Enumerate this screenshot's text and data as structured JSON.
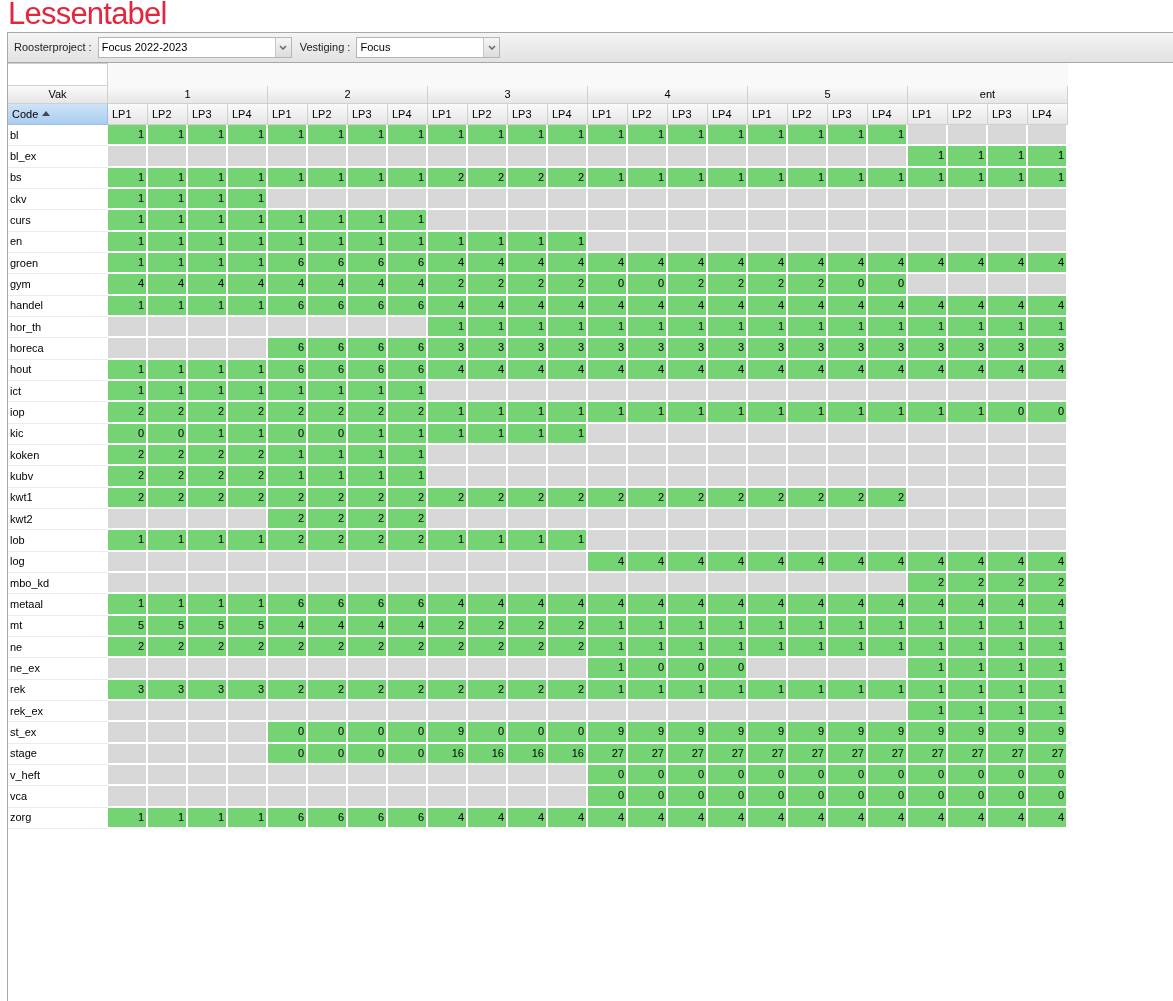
{
  "page_title": "Lessentabel",
  "toolbar": {
    "fields": [
      {
        "label": "Roosterproject :",
        "value": "Focus 2022-2023"
      },
      {
        "label": "Vestiging :",
        "value": "Focus"
      }
    ]
  },
  "table": {
    "corner_header": "Vak",
    "code_header": "Code",
    "sort_ascending": true,
    "groups": [
      {
        "label": "1",
        "periods": [
          "LP1",
          "LP2",
          "LP3",
          "LP4"
        ]
      },
      {
        "label": "2",
        "periods": [
          "LP1",
          "LP2",
          "LP3",
          "LP4"
        ]
      },
      {
        "label": "3",
        "periods": [
          "LP1",
          "LP2",
          "LP3",
          "LP4"
        ]
      },
      {
        "label": "4",
        "periods": [
          "LP1",
          "LP2",
          "LP3",
          "LP4"
        ]
      },
      {
        "label": "5",
        "periods": [
          "LP1",
          "LP2",
          "LP3",
          "LP4"
        ]
      },
      {
        "label": "ent",
        "periods": [
          "LP1",
          "LP2",
          "LP3",
          "LP4"
        ]
      }
    ],
    "rows": [
      {
        "code": "bl",
        "cells": [
          "1",
          "1",
          "1",
          "1",
          "1",
          "1",
          "1",
          "1",
          "1",
          "1",
          "1",
          "1",
          "1",
          "1",
          "1",
          "1",
          "1",
          "1",
          "1",
          "1",
          null,
          null,
          null,
          null
        ]
      },
      {
        "code": "bl_ex",
        "cells": [
          null,
          null,
          null,
          null,
          null,
          null,
          null,
          null,
          null,
          null,
          null,
          null,
          null,
          null,
          null,
          null,
          null,
          null,
          null,
          null,
          "1",
          "1",
          "1",
          "1"
        ]
      },
      {
        "code": "bs",
        "cells": [
          "1",
          "1",
          "1",
          "1",
          "1",
          "1",
          "1",
          "1",
          "2",
          "2",
          "2",
          "2",
          "1",
          "1",
          "1",
          "1",
          "1",
          "1",
          "1",
          "1",
          "1",
          "1",
          "1",
          "1"
        ]
      },
      {
        "code": "ckv",
        "cells": [
          "1",
          "1",
          "1",
          "1",
          null,
          null,
          null,
          null,
          null,
          null,
          null,
          null,
          null,
          null,
          null,
          null,
          null,
          null,
          null,
          null,
          null,
          null,
          null,
          null
        ]
      },
      {
        "code": "curs",
        "cells": [
          "1",
          "1",
          "1",
          "1",
          "1",
          "1",
          "1",
          "1",
          null,
          null,
          null,
          null,
          null,
          null,
          null,
          null,
          null,
          null,
          null,
          null,
          null,
          null,
          null,
          null
        ]
      },
      {
        "code": "en",
        "cells": [
          "1",
          "1",
          "1",
          "1",
          "1",
          "1",
          "1",
          "1",
          "1",
          "1",
          "1",
          "1",
          null,
          null,
          null,
          null,
          null,
          null,
          null,
          null,
          null,
          null,
          null,
          null
        ]
      },
      {
        "code": "groen",
        "cells": [
          "1",
          "1",
          "1",
          "1",
          "6",
          "6",
          "6",
          "6",
          "4",
          "4",
          "4",
          "4",
          "4",
          "4",
          "4",
          "4",
          "4",
          "4",
          "4",
          "4",
          "4",
          "4",
          "4",
          "4"
        ]
      },
      {
        "code": "gym",
        "cells": [
          "4",
          "4",
          "4",
          "4",
          "4",
          "4",
          "4",
          "4",
          "2",
          "2",
          "2",
          "2",
          "0",
          "0",
          "2",
          "2",
          "2",
          "2",
          "0",
          "0",
          null,
          null,
          null,
          null
        ]
      },
      {
        "code": "handel",
        "cells": [
          "1",
          "1",
          "1",
          "1",
          "6",
          "6",
          "6",
          "6",
          "4",
          "4",
          "4",
          "4",
          "4",
          "4",
          "4",
          "4",
          "4",
          "4",
          "4",
          "4",
          "4",
          "4",
          "4",
          "4"
        ]
      },
      {
        "code": "hor_th",
        "cells": [
          null,
          null,
          null,
          null,
          null,
          null,
          null,
          null,
          "1",
          "1",
          "1",
          "1",
          "1",
          "1",
          "1",
          "1",
          "1",
          "1",
          "1",
          "1",
          "1",
          "1",
          "1",
          "1"
        ]
      },
      {
        "code": "horeca",
        "cells": [
          null,
          null,
          null,
          null,
          "6",
          "6",
          "6",
          "6",
          "3",
          "3",
          "3",
          "3",
          "3",
          "3",
          "3",
          "3",
          "3",
          "3",
          "3",
          "3",
          "3",
          "3",
          "3",
          "3"
        ]
      },
      {
        "code": "hout",
        "cells": [
          "1",
          "1",
          "1",
          "1",
          "6",
          "6",
          "6",
          "6",
          "4",
          "4",
          "4",
          "4",
          "4",
          "4",
          "4",
          "4",
          "4",
          "4",
          "4",
          "4",
          "4",
          "4",
          "4",
          "4"
        ]
      },
      {
        "code": "ict",
        "cells": [
          "1",
          "1",
          "1",
          "1",
          "1",
          "1",
          "1",
          "1",
          null,
          null,
          null,
          null,
          null,
          null,
          null,
          null,
          null,
          null,
          null,
          null,
          null,
          null,
          null,
          null
        ]
      },
      {
        "code": "iop",
        "cells": [
          "2",
          "2",
          "2",
          "2",
          "2",
          "2",
          "2",
          "2",
          "1",
          "1",
          "1",
          "1",
          "1",
          "1",
          "1",
          "1",
          "1",
          "1",
          "1",
          "1",
          "1",
          "1",
          "0",
          "0"
        ]
      },
      {
        "code": "kic",
        "cells": [
          "0",
          "0",
          "1",
          "1",
          "0",
          "0",
          "1",
          "1",
          "1",
          "1",
          "1",
          "1",
          null,
          null,
          null,
          null,
          null,
          null,
          null,
          null,
          null,
          null,
          null,
          null
        ]
      },
      {
        "code": "koken",
        "cells": [
          "2",
          "2",
          "2",
          "2",
          "1",
          "1",
          "1",
          "1",
          null,
          null,
          null,
          null,
          null,
          null,
          null,
          null,
          null,
          null,
          null,
          null,
          null,
          null,
          null,
          null
        ]
      },
      {
        "code": "kubv",
        "cells": [
          "2",
          "2",
          "2",
          "2",
          "1",
          "1",
          "1",
          "1",
          null,
          null,
          null,
          null,
          null,
          null,
          null,
          null,
          null,
          null,
          null,
          null,
          null,
          null,
          null,
          null
        ]
      },
      {
        "code": "kwt1",
        "cells": [
          "2",
          "2",
          "2",
          "2",
          "2",
          "2",
          "2",
          "2",
          "2",
          "2",
          "2",
          "2",
          "2",
          "2",
          "2",
          "2",
          "2",
          "2",
          "2",
          "2",
          null,
          null,
          null,
          null
        ]
      },
      {
        "code": "kwt2",
        "cells": [
          null,
          null,
          null,
          null,
          "2",
          "2",
          "2",
          "2",
          null,
          null,
          null,
          null,
          null,
          null,
          null,
          null,
          null,
          null,
          null,
          null,
          null,
          null,
          null,
          null
        ]
      },
      {
        "code": "lob",
        "cells": [
          "1",
          "1",
          "1",
          "1",
          "2",
          "2",
          "2",
          "2",
          "1",
          "1",
          "1",
          "1",
          null,
          null,
          null,
          null,
          null,
          null,
          null,
          null,
          null,
          null,
          null,
          null
        ]
      },
      {
        "code": "log",
        "cells": [
          null,
          null,
          null,
          null,
          null,
          null,
          null,
          null,
          null,
          null,
          null,
          null,
          "4",
          "4",
          "4",
          "4",
          "4",
          "4",
          "4",
          "4",
          "4",
          "4",
          "4",
          "4"
        ]
      },
      {
        "code": "mbo_kd",
        "cells": [
          null,
          null,
          null,
          null,
          null,
          null,
          null,
          null,
          null,
          null,
          null,
          null,
          null,
          null,
          null,
          null,
          null,
          null,
          null,
          null,
          "2",
          "2",
          "2",
          "2"
        ]
      },
      {
        "code": "metaal",
        "cells": [
          "1",
          "1",
          "1",
          "1",
          "6",
          "6",
          "6",
          "6",
          "4",
          "4",
          "4",
          "4",
          "4",
          "4",
          "4",
          "4",
          "4",
          "4",
          "4",
          "4",
          "4",
          "4",
          "4",
          "4"
        ]
      },
      {
        "code": "mt",
        "cells": [
          "5",
          "5",
          "5",
          "5",
          "4",
          "4",
          "4",
          "4",
          "2",
          "2",
          "2",
          "2",
          "1",
          "1",
          "1",
          "1",
          "1",
          "1",
          "1",
          "1",
          "1",
          "1",
          "1",
          "1"
        ]
      },
      {
        "code": "ne",
        "cells": [
          "2",
          "2",
          "2",
          "2",
          "2",
          "2",
          "2",
          "2",
          "2",
          "2",
          "2",
          "2",
          "1",
          "1",
          "1",
          "1",
          "1",
          "1",
          "1",
          "1",
          "1",
          "1",
          "1",
          "1"
        ]
      },
      {
        "code": "ne_ex",
        "cells": [
          null,
          null,
          null,
          null,
          null,
          null,
          null,
          null,
          null,
          null,
          null,
          null,
          "1",
          "0",
          "0",
          "0",
          null,
          null,
          null,
          null,
          "1",
          "1",
          "1",
          "1"
        ]
      },
      {
        "code": "rek",
        "cells": [
          "3",
          "3",
          "3",
          "3",
          "2",
          "2",
          "2",
          "2",
          "2",
          "2",
          "2",
          "2",
          "1",
          "1",
          "1",
          "1",
          "1",
          "1",
          "1",
          "1",
          "1",
          "1",
          "1",
          "1"
        ]
      },
      {
        "code": "rek_ex",
        "cells": [
          null,
          null,
          null,
          null,
          null,
          null,
          null,
          null,
          null,
          null,
          null,
          null,
          null,
          null,
          null,
          null,
          null,
          null,
          null,
          null,
          "1",
          "1",
          "1",
          "1"
        ]
      },
      {
        "code": "st_ex",
        "cells": [
          null,
          null,
          null,
          null,
          "0",
          "0",
          "0",
          "0",
          "9",
          "0",
          "0",
          "0",
          "9",
          "9",
          "9",
          "9",
          "9",
          "9",
          "9",
          "9",
          "9",
          "9",
          "9",
          "9"
        ]
      },
      {
        "code": "stage",
        "cells": [
          null,
          null,
          null,
          null,
          "0",
          "0",
          "0",
          "0",
          "16",
          "16",
          "16",
          "16",
          "27",
          "27",
          "27",
          "27",
          "27",
          "27",
          "27",
          "27",
          "27",
          "27",
          "27",
          "27"
        ]
      },
      {
        "code": "v_heft",
        "cells": [
          null,
          null,
          null,
          null,
          null,
          null,
          null,
          null,
          null,
          null,
          null,
          null,
          "0",
          "0",
          "0",
          "0",
          "0",
          "0",
          "0",
          "0",
          "0",
          "0",
          "0",
          "0"
        ]
      },
      {
        "code": "vca",
        "cells": [
          null,
          null,
          null,
          null,
          null,
          null,
          null,
          null,
          null,
          null,
          null,
          null,
          "0",
          "0",
          "0",
          "0",
          "0",
          "0",
          "0",
          "0",
          "0",
          "0",
          "0",
          "0"
        ]
      },
      {
        "code": "zorg",
        "cells": [
          "1",
          "1",
          "1",
          "1",
          "6",
          "6",
          "6",
          "6",
          "4",
          "4",
          "4",
          "4",
          "4",
          "4",
          "4",
          "4",
          "4",
          "4",
          "4",
          "4",
          "4",
          "4",
          "4",
          "4"
        ]
      }
    ]
  }
}
